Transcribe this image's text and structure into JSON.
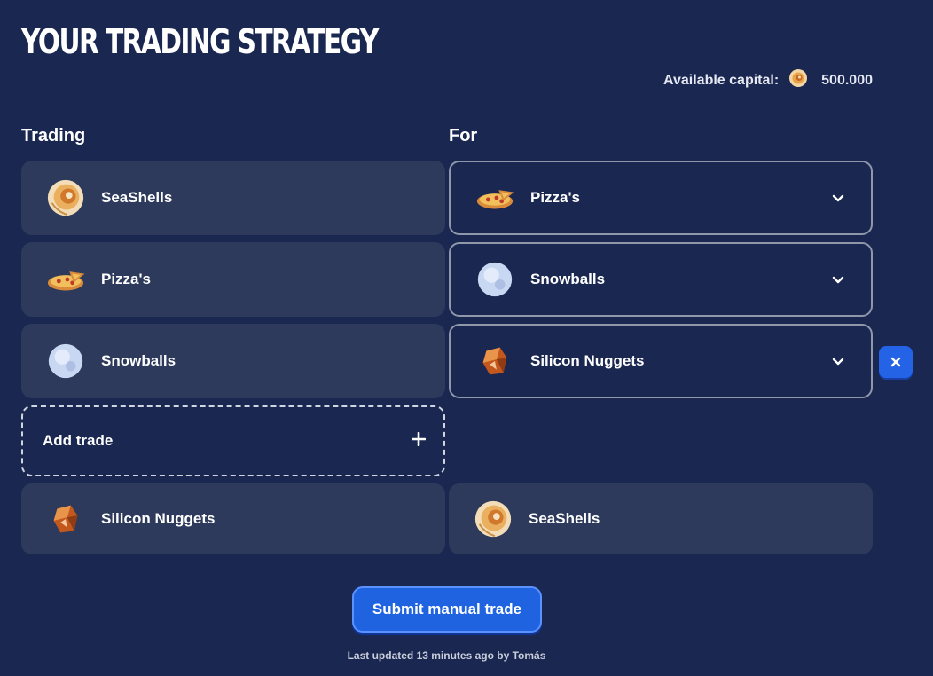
{
  "header": {
    "title": "YOUR TRADING STRATEGY"
  },
  "capital": {
    "label": "Available capital:",
    "amount": "500.000",
    "icon": "seashell-icon"
  },
  "columns": {
    "trading": "Trading",
    "for": "For"
  },
  "trades": [
    {
      "from": "SeaShells",
      "from_icon": "seashell-icon",
      "to": "Pizza's",
      "to_icon": "pizza-icon"
    },
    {
      "from": "Pizza's",
      "from_icon": "pizza-icon",
      "to": "Snowballs",
      "to_icon": "snowball-icon"
    },
    {
      "from": "Snowballs",
      "from_icon": "snowball-icon",
      "to": "Silicon Nuggets",
      "to_icon": "silicon-nugget-icon"
    }
  ],
  "add_trade": {
    "label": "Add trade"
  },
  "final_trade": {
    "from": "Silicon Nuggets",
    "to": "SeaShells"
  },
  "actions": {
    "submit_label": "Submit manual trade",
    "remove_label": "×"
  },
  "footer": {
    "last_updated": "Last updated 13 minutes ago by Tomás"
  },
  "colors": {
    "background": "#1a2750",
    "card": "#2d3a5c",
    "accent": "#1f63e0"
  }
}
